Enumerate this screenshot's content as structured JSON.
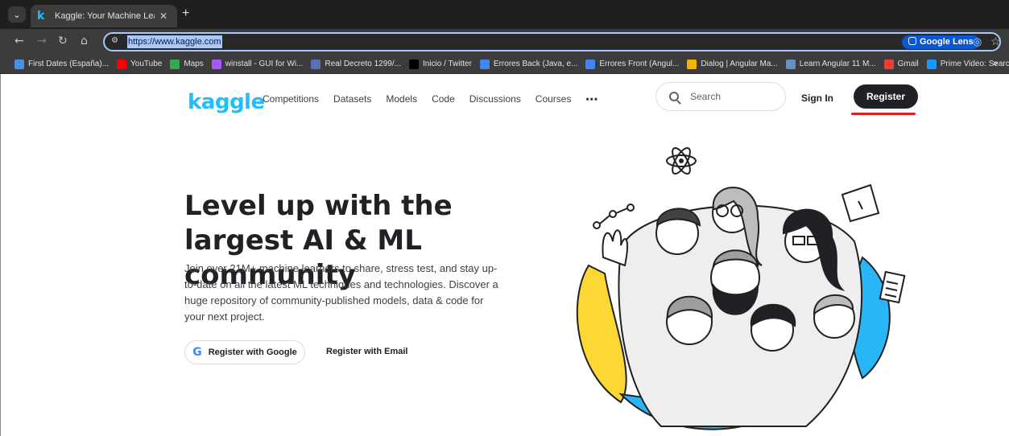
{
  "browser": {
    "tab_title": "Kaggle: Your Machine Learning",
    "tab_favicon": "k",
    "url": "https://www.kaggle.com",
    "lens_label": "Google Lens",
    "bookmarks": [
      {
        "label": "First Dates (España)...",
        "color": "#4a90e2"
      },
      {
        "label": "YouTube",
        "color": "#ff0000"
      },
      {
        "label": "Maps",
        "color": "#34a853"
      },
      {
        "label": "winstall - GUI for Wi...",
        "color": "#a259ff"
      },
      {
        "label": "Real Decreto 1299/...",
        "color": "#5b6fb5"
      },
      {
        "label": "Inicio / Twitter",
        "color": "#000000"
      },
      {
        "label": "Errores Back (Java, e...",
        "color": "#4285f4"
      },
      {
        "label": "Errores Front (Angul...",
        "color": "#4285f4"
      },
      {
        "label": "Dialog | Angular Ma...",
        "color": "#f4b400"
      },
      {
        "label": "Learn Angular 11 M...",
        "color": "#6c8ebf"
      },
      {
        "label": "Gmail",
        "color": "#ea4335"
      },
      {
        "label": "Prime Video: Search",
        "color": "#1a98ff"
      }
    ],
    "bookmarks_more": "»"
  },
  "header": {
    "logo": "kaggle",
    "nav": [
      "Competitions",
      "Datasets",
      "Models",
      "Code",
      "Discussions",
      "Courses"
    ],
    "nav_more": "•••",
    "search_placeholder": "Search",
    "signin": "Sign In",
    "register": "Register"
  },
  "hero": {
    "title": "Level up with the largest AI & ML community",
    "subtitle": "Join over 21M+ machine learners to share, stress test, and stay up-to-date on all the latest ML techniques and technologies. Discover a huge repository of community-published models, data & code for your next project.",
    "google_button": "Register with Google",
    "email_button": "Register with Email"
  },
  "colors": {
    "brand": "#20beff",
    "accent_yellow": "#fdd835",
    "accent_blue": "#29b6f6",
    "underline": "#e02020"
  }
}
